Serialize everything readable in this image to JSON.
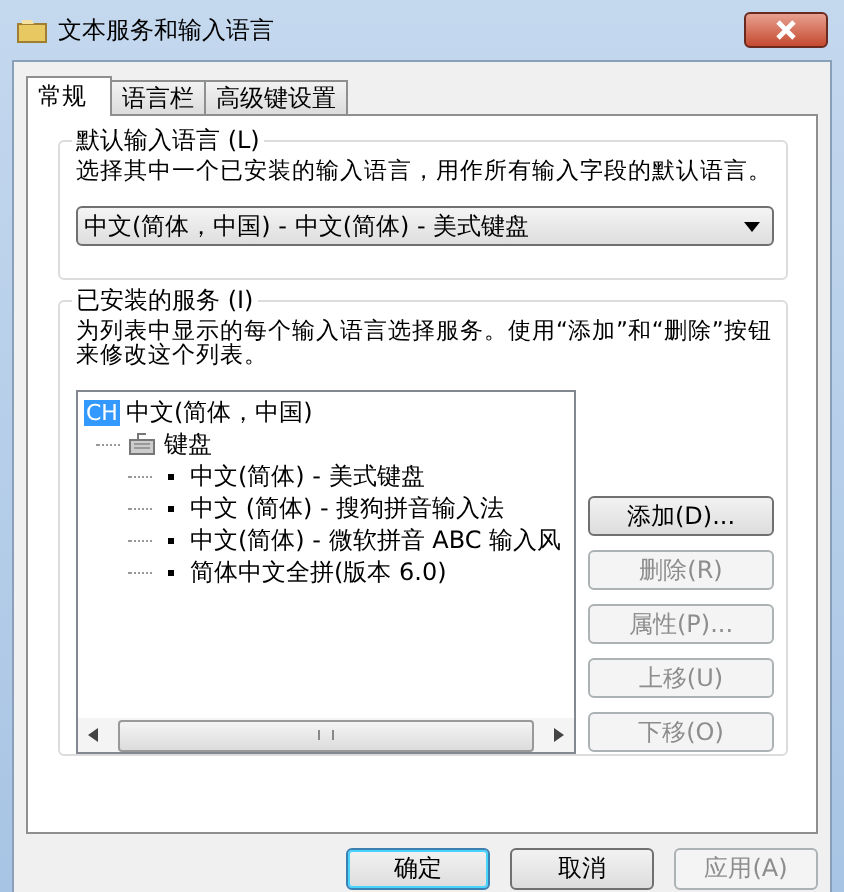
{
  "window": {
    "title": "文本服务和输入语言"
  },
  "tabs": [
    {
      "label": "常规",
      "selected": true
    },
    {
      "label": "语言栏",
      "selected": false
    },
    {
      "label": "高级键设置",
      "selected": false
    }
  ],
  "default_language": {
    "legend": "默认输入语言 (L)",
    "description": "选择其中一个已安装的输入语言，用作所有输入字段的默认语言。",
    "value": "中文(简体，中国) - 中文(简体) - 美式键盘"
  },
  "installed_services": {
    "legend": "已安装的服务 (I)",
    "description": "为列表中显示的每个输入语言选择服务。使用“添加”和“删除”按钮来修改这个列表。",
    "tree": [
      {
        "badge": "CH",
        "label": "中文(简体，中国)",
        "children": [
          {
            "label": "键盘",
            "children": [
              {
                "label": "中文(简体) - 美式键盘"
              },
              {
                "label": "中文 (简体) - 搜狗拼音输入法"
              },
              {
                "label": "中文(简体) - 微软拼音 ABC 输入风"
              },
              {
                "label": "简体中文全拼(版本 6.0)"
              }
            ]
          }
        ]
      }
    ],
    "buttons": [
      {
        "label": "添加(D)...",
        "disabled": false
      },
      {
        "label": "删除(R)",
        "disabled": true
      },
      {
        "label": "属性(P)...",
        "disabled": true
      },
      {
        "label": "上移(U)",
        "disabled": true
      },
      {
        "label": "下移(O)",
        "disabled": true
      }
    ]
  },
  "dialog_buttons": [
    {
      "label": "确定",
      "disabled": false,
      "default": true
    },
    {
      "label": "取消",
      "disabled": false,
      "default": false
    },
    {
      "label": "应用(A)",
      "disabled": true,
      "default": false
    }
  ]
}
